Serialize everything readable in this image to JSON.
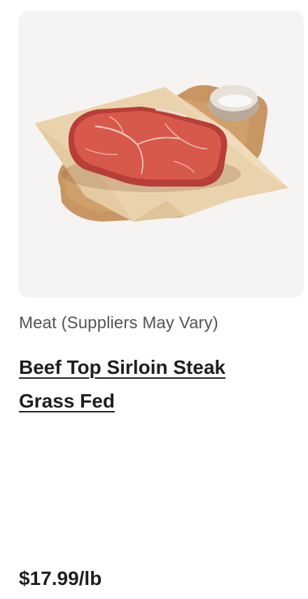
{
  "product": {
    "image_subject": "beef-steak-on-cutting-board",
    "supplier": "Meat (Suppliers May Vary)",
    "title_line1": "Beef Top Sirloin Steak",
    "title_line2": "Grass Fed",
    "price": "$17.99/lb"
  },
  "colors": {
    "image_background": "#f5f4f2",
    "text_primary": "#1f1f1f",
    "text_secondary": "#555555"
  }
}
